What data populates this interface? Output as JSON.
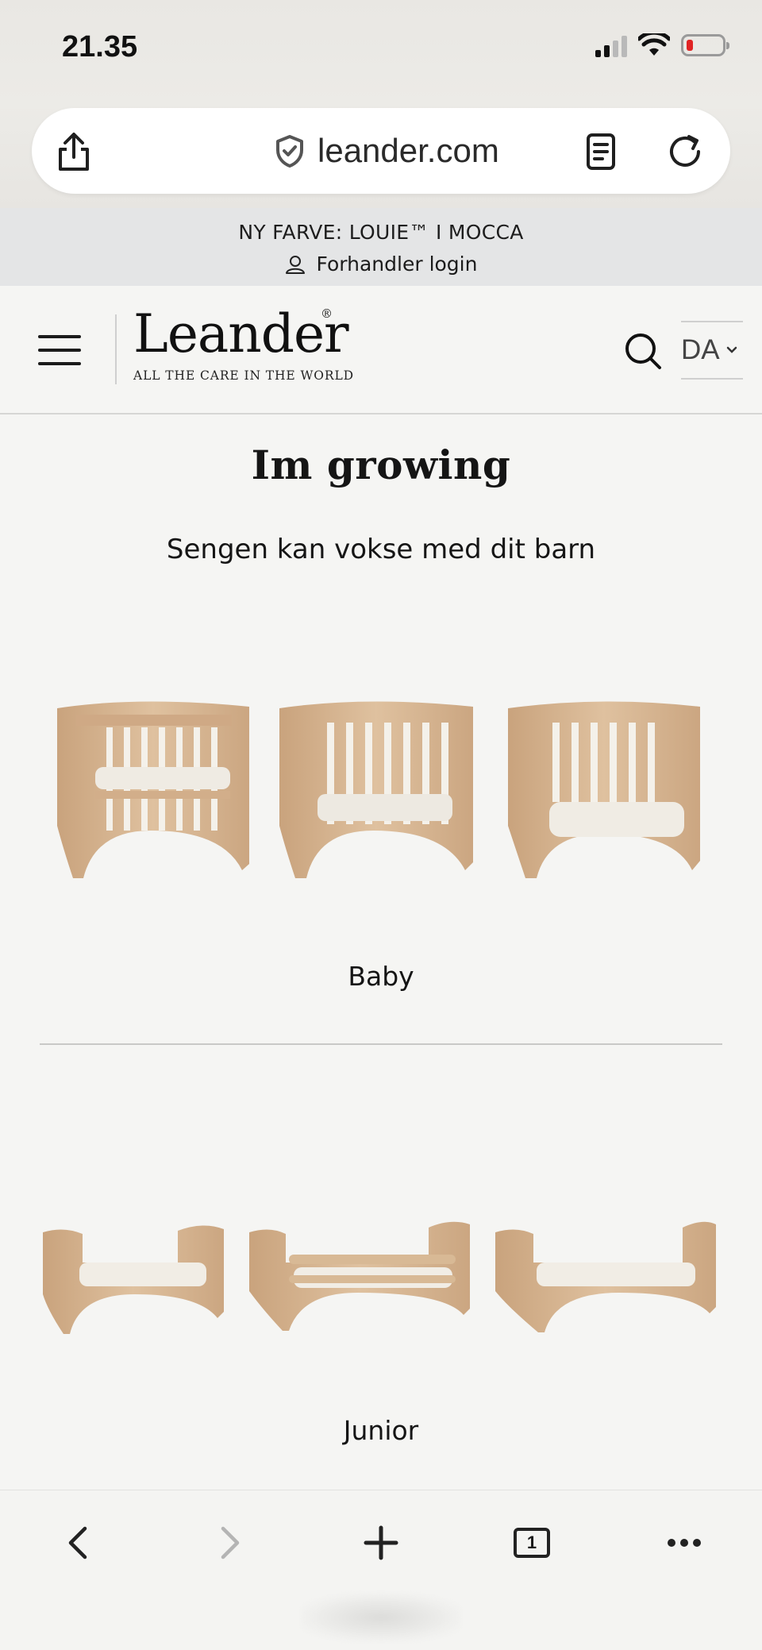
{
  "status_bar": {
    "time": "21.35"
  },
  "browser": {
    "url": "leander.com",
    "icons": [
      "share-icon",
      "shield-check-icon",
      "reader-icon",
      "reload-icon"
    ]
  },
  "announcement": {
    "headline": "NY FARVE: LOUIE™ I MOCCA",
    "dealer_login": "Forhandler login"
  },
  "header": {
    "brand": "Leander",
    "registered_mark": "®",
    "tagline": "ALL THE CARE IN THE WORLD",
    "language": "DA"
  },
  "main": {
    "title": "Im growing",
    "subtitle": "Sengen kan vokse med dit barn",
    "stages": [
      {
        "label": "Baby"
      },
      {
        "label": "Junior"
      }
    ]
  },
  "toolbar": {
    "tab_count": "1"
  },
  "colors": {
    "page_bg": "#f5f5f3",
    "announce_bg": "#e4e5e6",
    "wood": "#d9b894",
    "mattress": "#f1ede4",
    "battery_low": "#e02424"
  }
}
